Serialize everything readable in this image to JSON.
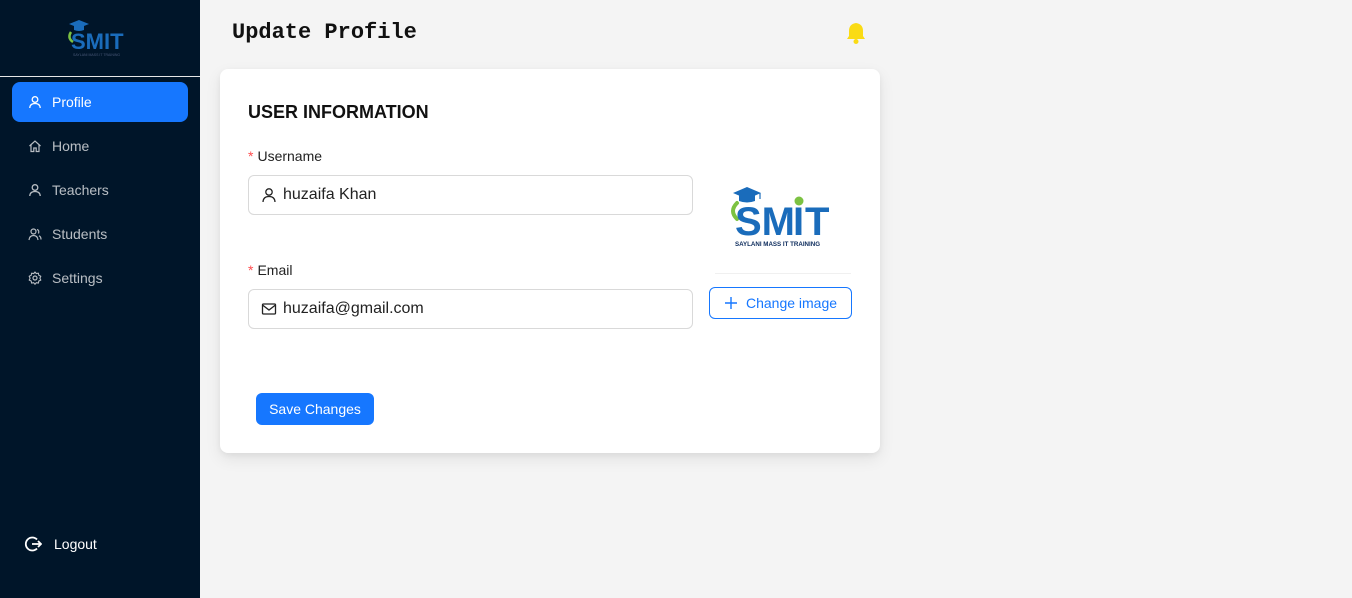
{
  "brand": {
    "logo_text": "SMIT",
    "logo_tagline": "SAYLANI MASS IT TRAINING",
    "colors": {
      "blue": "#1a6cbb",
      "green": "#7cc242",
      "navy": "#0b2a5b"
    }
  },
  "sidebar": {
    "items": [
      {
        "label": "Profile",
        "icon": "user-icon",
        "active": true
      },
      {
        "label": "Home",
        "icon": "home-icon",
        "active": false
      },
      {
        "label": "Teachers",
        "icon": "user-icon",
        "active": false
      },
      {
        "label": "Students",
        "icon": "team-icon",
        "active": false
      },
      {
        "label": "Settings",
        "icon": "gear-icon",
        "active": false
      }
    ],
    "logout_label": "Logout"
  },
  "header": {
    "title": "Update Profile",
    "notification_icon": "bell-icon",
    "notification_color": "#fadb14"
  },
  "card": {
    "title": "USER INFORMATION",
    "username": {
      "label": "Username",
      "value": "huzaifa Khan",
      "icon": "user-icon"
    },
    "email": {
      "label": "Email",
      "value": "huzaifa@gmail.com",
      "icon": "mail-icon"
    },
    "change_image_label": "Change image",
    "save_label": "Save Changes"
  },
  "theme": {
    "sidebar_bg": "#001529",
    "primary": "#1677ff",
    "page_bg": "#f4f4f4",
    "required": "#ff4d4f"
  }
}
